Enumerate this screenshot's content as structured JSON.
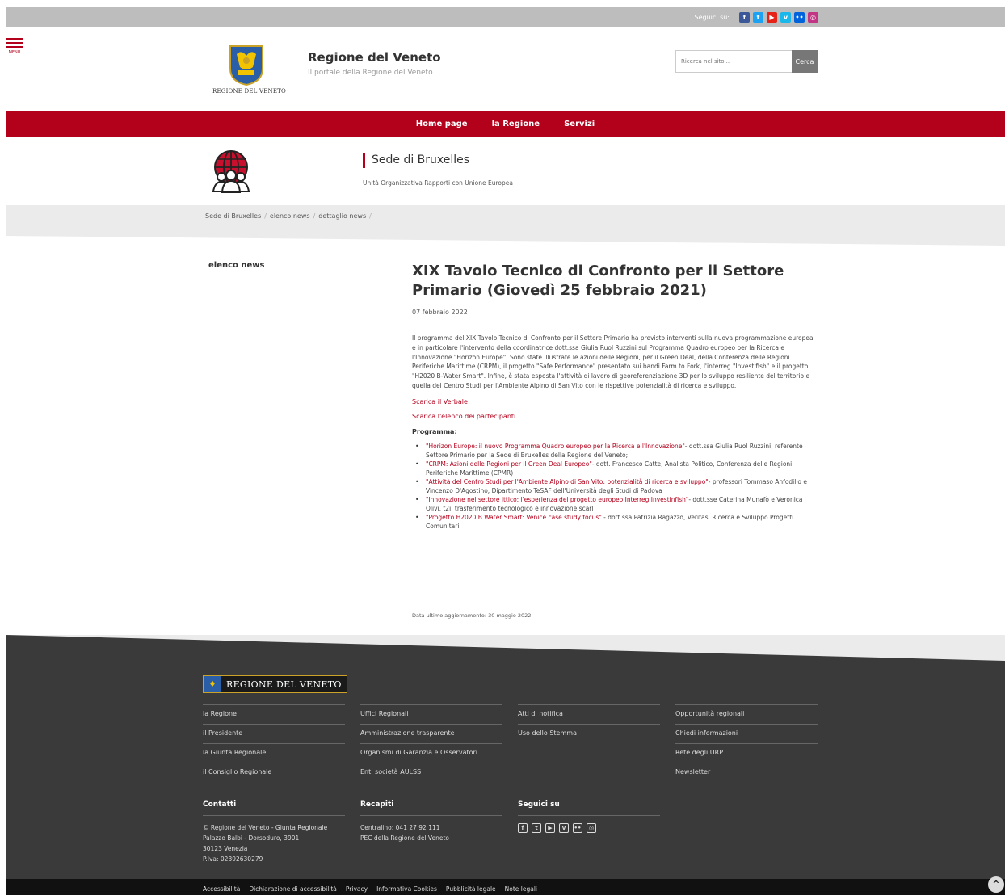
{
  "topbar": {
    "seguici_label": "Seguici su:",
    "social_icons": [
      {
        "name": "facebook-icon",
        "glyph": "f",
        "color": "#3b5998"
      },
      {
        "name": "twitter-icon",
        "glyph": "t",
        "color": "#1da1f2"
      },
      {
        "name": "youtube-icon",
        "glyph": "▶",
        "color": "#e62117"
      },
      {
        "name": "vimeo-icon",
        "glyph": "v",
        "color": "#1ab7ea"
      },
      {
        "name": "flickr-icon",
        "glyph": "••",
        "color": "#0063dc"
      },
      {
        "name": "instagram-icon",
        "glyph": "◎",
        "color": "#c13584"
      }
    ]
  },
  "header": {
    "menu_label": "MENU",
    "crest_caption": "REGIONE DEL VENETO",
    "title": "Regione del Veneto",
    "subtitle": "Il portale della Regione del Veneto",
    "search_placeholder": "Ricerca nel sito...",
    "search_button": "Cerca"
  },
  "nav": {
    "items": [
      "Home page",
      "la Regione",
      "Servizi"
    ]
  },
  "sede": {
    "title": "Sede di Bruxelles",
    "subtitle": "Unità Organizzativa Rapporti con Unione Europea"
  },
  "breadcrumb": [
    "Sede di Bruxelles",
    "elenco news",
    "dettaglio news"
  ],
  "sidebar": {
    "title": "elenco news"
  },
  "article": {
    "title": "XIX Tavolo Tecnico di Confronto per il Settore Primario (Giovedì 25 febbraio 2021)",
    "date": "07 febbraio 2022",
    "body": "Il programma del XIX Tavolo Tecnico di Confronto per il Settore Primario ha previsto interventi sulla nuova programmazione europea e in particolare l'intervento della coordinatrice dott.ssa Giulia Ruol Ruzzini sul Programma Quadro europeo per la Ricerca e l'Innovazione \"Horizon Europe\". Sono state illustrate le azioni delle Regioni, per il Green Deal, della Conferenza delle Regioni Periferiche Marittime (CRPM), il progetto \"Safe Performance\" presentato sui bandi Farm to Fork, l'interreg \"Investifish\" e il progetto \"H2020 B-Water Smart\". Infine, è stata esposta l'attività di lavoro di georeferenziazione 3D per lo sviluppo resiliente del territorio e quella del Centro Studi per l'Ambiente Alpino di San Vito con le rispettive potenzialità di ricerca e sviluppo.",
    "link_verbale": "Scarica il Verbale",
    "link_partecipanti": "Scarica l'elenco dei partecipanti",
    "programma_title": "Programma:",
    "programma": [
      {
        "link": "\"Horizon Europe: il nuovo Programma Quadro europeo per la Ricerca e l'Innovazione\"",
        "text": "- dott.ssa Giulia Ruol Ruzzini, referente Settore Primario per la Sede di Bruxelles della Regione del Veneto;"
      },
      {
        "link": "\"CRPM: Azioni delle Regioni per il Green Deal Europeo\"",
        "text": "- dott. Francesco Catte, Analista Politico, Conferenza delle Regioni Periferiche Marittime (CPMR)"
      },
      {
        "link": "\"Attività del Centro Studi per l'Ambiente Alpino di San Vito: potenzialità di ricerca e sviluppo\"",
        "text": "- professori Tommaso Anfodillo e Vincenzo D'Agostino, Dipartimento TeSAF dell'Università degli Studi di Padova"
      },
      {
        "link": "\"Innovazione nel settore ittico: l'esperienza del progetto europeo Interreg Investinfish\"",
        "text": "- dott.sse Caterina Munafò e Veronica Olivi, t2i, trasferimento tecnologico e innovazione scarl"
      },
      {
        "link": "\"Progetto H2020 B Water Smart: Venice case study focus\"",
        "text": " - dott.ssa Patrizia Ragazzo, Veritas, Ricerca e Sviluppo Progetti Comunitari"
      }
    ],
    "last_update": "Data ultimo aggiornamento: 30 maggio 2022"
  },
  "footer": {
    "logo_text": "REGIONE DEL VENETO",
    "columns": [
      [
        "la Regione",
        "il Presidente",
        "la Giunta Regionale",
        "il Consiglio Regionale"
      ],
      [
        "Uffici Regionali",
        "Amministrazione trasparente",
        "Organismi di Garanzia e Osservatori",
        "Enti società AULSS"
      ],
      [
        "Atti di notifica",
        "Uso dello Stemma"
      ],
      [
        "Opportunità regionali",
        "Chiedi informazioni",
        "Rete degli URP",
        "Newsletter"
      ]
    ],
    "contatti_title": "Contatti",
    "contatti_lines": [
      "© Regione del Veneto - Giunta Regionale",
      "Palazzo Balbi - Dorsoduro, 3901",
      "30123 Venezia",
      "P.Iva: 02392630279"
    ],
    "recapiti_title": "Recapiti",
    "recapiti_lines": [
      "Centralino: 041 27 92 111",
      "PEC della Regione del Veneto"
    ],
    "seguici_title": "Seguici su"
  },
  "bottom": {
    "links": [
      "Accessibilità",
      "Dichiarazione di accessibilità",
      "Privacy",
      "Informativa Cookies",
      "Pubblicità legale",
      "Note legali"
    ]
  }
}
